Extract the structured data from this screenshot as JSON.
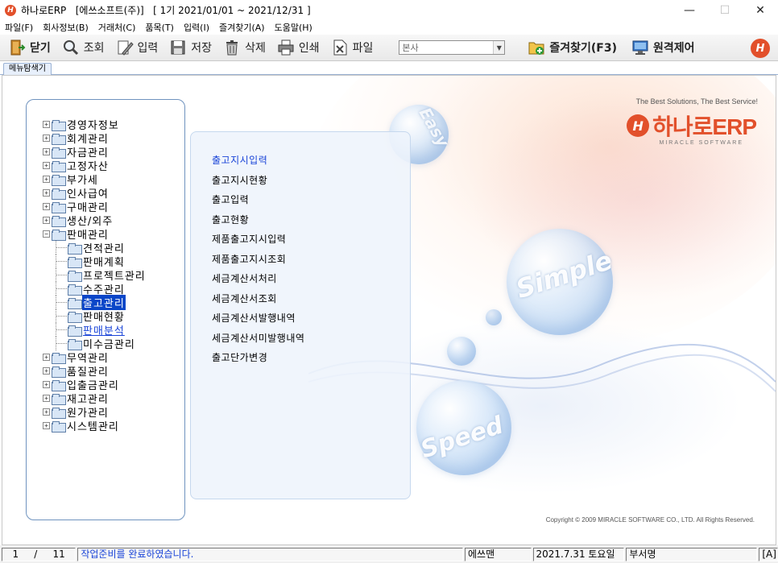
{
  "window": {
    "title": "하나로ERP   [에쓰소프트(주)]   [ 1기 2021/01/01 ~ 2021/12/31 ]",
    "logo_text": "H",
    "controls": [
      "—",
      "☐",
      "✕"
    ]
  },
  "menubar": [
    "파일(F)",
    "회사정보(B)",
    "거래처(C)",
    "품목(T)",
    "입력(I)",
    "즐겨찾기(A)",
    "도움말(H)"
  ],
  "toolbar": {
    "close": "닫기",
    "search": "조회",
    "input": "입력",
    "save": "저장",
    "delete": "삭제",
    "print": "인쇄",
    "file": "파일",
    "branch_value": "본사",
    "favorites": "즐겨찾기(F3)",
    "remote": "원격제어"
  },
  "tab": {
    "label": "메뉴탐색기"
  },
  "tree": {
    "items": [
      {
        "label": "경영자정보",
        "expander": "+"
      },
      {
        "label": "회계관리",
        "expander": "+"
      },
      {
        "label": "자금관리",
        "expander": "+"
      },
      {
        "label": "고정자산",
        "expander": "+"
      },
      {
        "label": "부가세",
        "expander": "+"
      },
      {
        "label": "인사급여",
        "expander": "+"
      },
      {
        "label": "구매관리",
        "expander": "+"
      },
      {
        "label": "생산/외주",
        "expander": "+"
      },
      {
        "label": "판매관리",
        "expander": "−"
      }
    ],
    "children": [
      {
        "label": "견적관리"
      },
      {
        "label": "판매계획"
      },
      {
        "label": "프로젝트관리"
      },
      {
        "label": "수주관리"
      },
      {
        "label": "출고관리"
      },
      {
        "label": "판매현황"
      },
      {
        "label": "판매분석"
      },
      {
        "label": "미수금관리"
      }
    ],
    "rest": [
      {
        "label": "무역관리",
        "expander": "+"
      },
      {
        "label": "품질관리",
        "expander": "+"
      },
      {
        "label": "입출금관리",
        "expander": "+"
      },
      {
        "label": "재고관리",
        "expander": "+"
      },
      {
        "label": "원가관리",
        "expander": "+"
      },
      {
        "label": "시스템관리",
        "expander": "+"
      }
    ],
    "selected_index": 4,
    "hovered_index": 6
  },
  "submenu": {
    "items": [
      "출고지시입력",
      "출고지시현황",
      "출고입력",
      "출고현황",
      "제품출고지시입력",
      "제품출고지시조회",
      "세금계산서처리",
      "세금계산서조회",
      "세금계산서발행내역",
      "세금계산서미발행내역",
      "출고단가변경"
    ],
    "active_index": 0
  },
  "brand": {
    "slogan": "The Best Solutions, The Best Service!",
    "name": "하나로ERP",
    "subtitle": "MIRACLE SOFTWARE",
    "copyright": "Copyright © 2009 MIRACLE SOFTWARE CO., LTD. All Rights Reserved."
  },
  "bubbles": [
    "Easy",
    "Simple",
    "Speed"
  ],
  "statusbar": {
    "page_current": "1",
    "page_sep": "/",
    "page_total": "11",
    "message": "작업준비를 완료하였습니다.",
    "user": "에쓰맨",
    "date": "2021.7.31 토요일",
    "dept": "부서명",
    "mode": "[A]"
  },
  "colors": {
    "brand": "#e2502b",
    "selection": "#0a46c8",
    "link": "#1b45d8"
  }
}
